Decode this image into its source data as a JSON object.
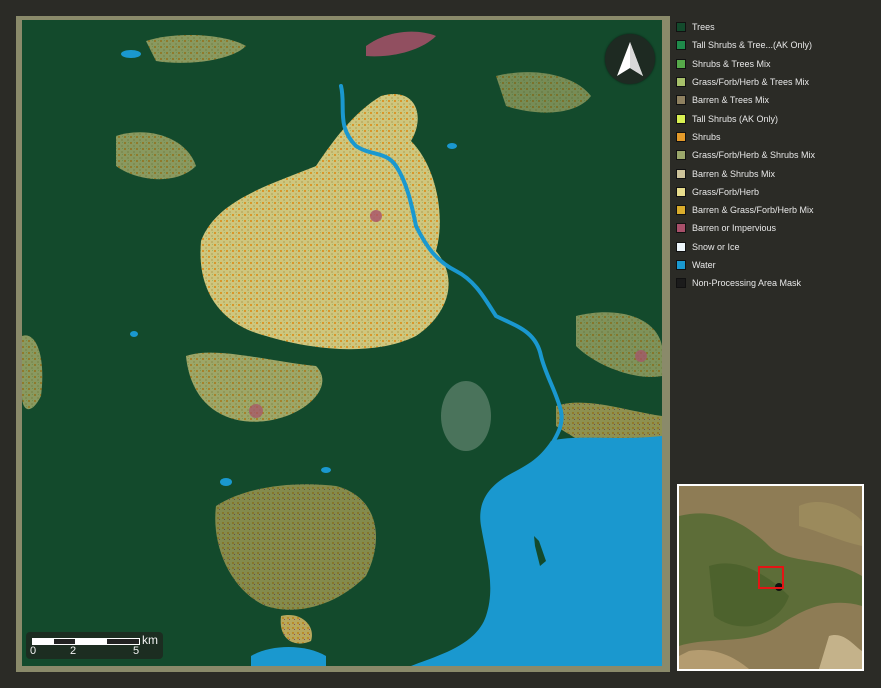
{
  "map": {
    "north_arrow_icon": "north-arrow-icon",
    "scale_bar": {
      "tick_labels": [
        "0",
        "2",
        "5"
      ],
      "unit": "km"
    },
    "colors": {
      "trees": "#134a2c",
      "water": "#1a8fc0"
    }
  },
  "legend": {
    "items": [
      {
        "label": "Trees",
        "color": "#134a2c"
      },
      {
        "label": "Tall Shrubs & Tree...(AK Only)",
        "color": "#1f8a4a"
      },
      {
        "label": "Shrubs & Trees Mix",
        "color": "#56a94a"
      },
      {
        "label": "Grass/Forb/Herb & Trees Mix",
        "color": "#a7c06a"
      },
      {
        "label": "Barren & Trees Mix",
        "color": "#8f8160"
      },
      {
        "label": "Tall Shrubs (AK Only)",
        "color": "#d8f052"
      },
      {
        "label": "Shrubs",
        "color": "#e39a2a"
      },
      {
        "label": "Grass/Forb/Herb & Shrubs Mix",
        "color": "#9aa66a"
      },
      {
        "label": "Barren & Shrubs Mix",
        "color": "#cdc39a"
      },
      {
        "label": "Grass/Forb/Herb",
        "color": "#e7dc8c"
      },
      {
        "label": "Barren & Grass/Forb/Herb Mix",
        "color": "#d9ac2c"
      },
      {
        "label": "Barren or Impervious",
        "color": "#a8506a"
      },
      {
        "label": "Snow or Ice",
        "color": "#eef6fb"
      },
      {
        "label": "Water",
        "color": "#1a98cf"
      },
      {
        "label": "Non-Processing Area Mask",
        "color": "#1b1b1b"
      }
    ]
  },
  "inset_map": {
    "extent_color": "#e41515"
  }
}
